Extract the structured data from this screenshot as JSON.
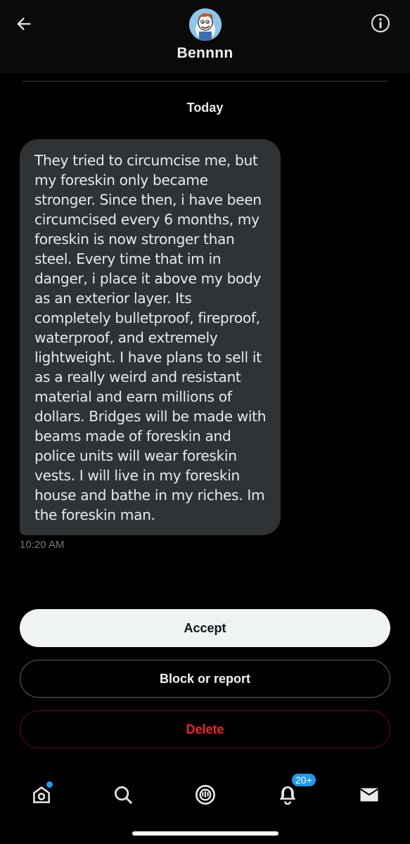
{
  "header": {
    "name": "Bennnn",
    "back_icon": "arrow-left-icon",
    "info_icon": "info-icon"
  },
  "conversation": {
    "date_label": "Today",
    "messages": [
      {
        "text": "They tried to circumcise me, but\nmy foreskin only became\nstronger. Since then, i have been\ncircumcised every 6 months, my\nforeskin is now stronger than\nsteel. Every time that im in\ndanger, i place it above my body\nas an exterior layer. Its\ncompletely bulletproof, fireproof,\nwaterproof, and extremely\nlightweight. I have plans to sell it\nas a really weird and resistant\nmaterial and earn millions of\ndollars. Bridges will be made with\nbeams made of foreskin and\npolice units will wear foreskin\nvests. I will live in my foreskin\nhouse and bathe in my riches. Im\nthe foreskin man.",
        "time": "10:20 AM"
      }
    ]
  },
  "actions": {
    "accept_label": "Accept",
    "block_label": "Block or report",
    "delete_label": "Delete"
  },
  "tabbar": {
    "items": [
      {
        "icon": "home-icon",
        "has_dot": true
      },
      {
        "icon": "search-icon"
      },
      {
        "icon": "spaces-icon"
      },
      {
        "icon": "bell-icon",
        "badge": "20+"
      },
      {
        "icon": "mail-icon"
      }
    ]
  },
  "colors": {
    "accent": "#1d9bf0",
    "danger": "#f4212e",
    "bubble": "#2f3336",
    "background": "#000000"
  }
}
